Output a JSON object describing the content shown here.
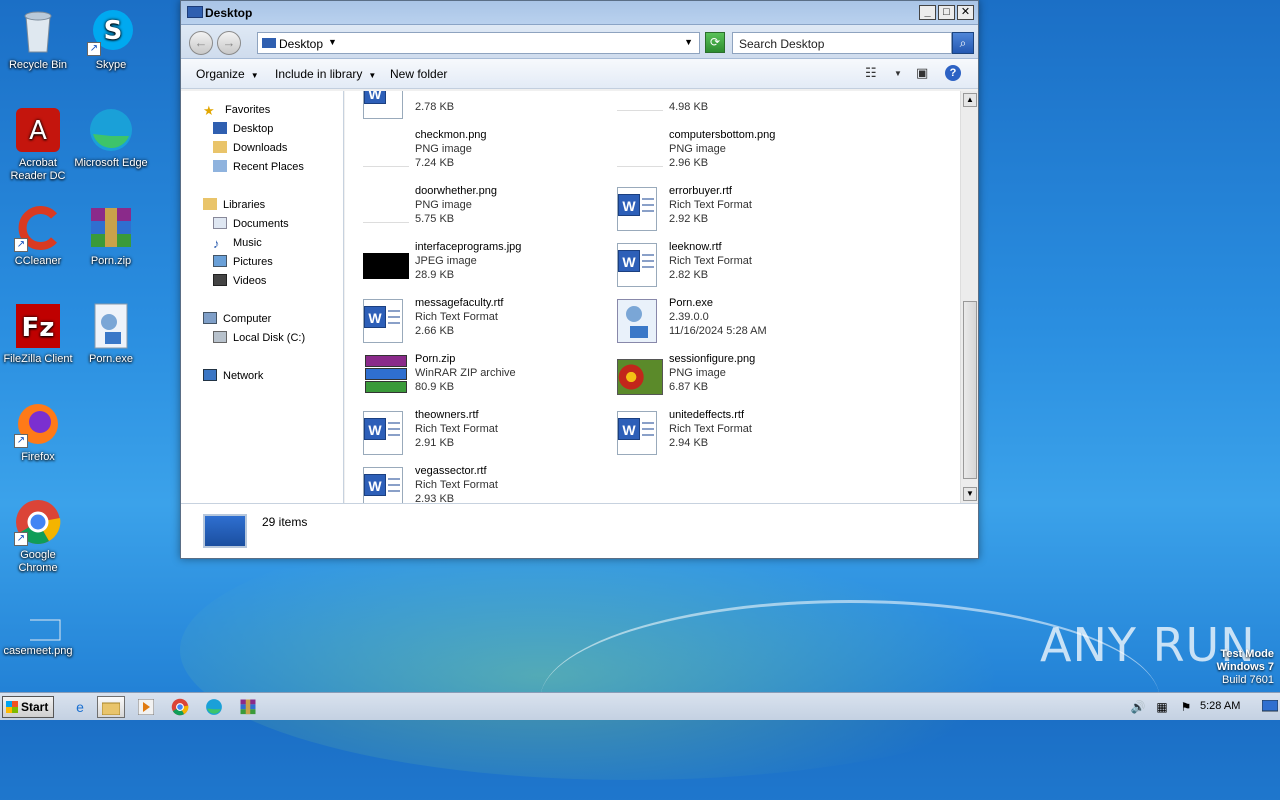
{
  "desktop": {
    "icons": [
      {
        "label": "Recycle Bin"
      },
      {
        "label": "Skype"
      },
      {
        "label": "Acrobat Reader DC"
      },
      {
        "label": "Microsoft Edge"
      },
      {
        "label": "CCleaner"
      },
      {
        "label": "Porn.zip"
      },
      {
        "label": "FileZilla Client"
      },
      {
        "label": "Porn.exe"
      },
      {
        "label": "Firefox"
      },
      {
        "label": "Google Chrome"
      },
      {
        "label": "casemeet.png"
      }
    ]
  },
  "window": {
    "title": "Desktop",
    "address": "Desktop",
    "search_placeholder": "Search Desktop",
    "toolbar": {
      "organize": "Organize",
      "include_in_library": "Include in library",
      "new_folder": "New folder"
    },
    "nav": {
      "favorites": "Favorites",
      "desktop": "Desktop",
      "downloads": "Downloads",
      "recent_places": "Recent Places",
      "libraries": "Libraries",
      "documents": "Documents",
      "music": "Music",
      "pictures": "Pictures",
      "videos": "Videos",
      "computer": "Computer",
      "local_disk": "Local Disk (C:)",
      "network": "Network"
    },
    "files": [
      {
        "name": "",
        "type": "",
        "size": "2.78 KB",
        "icon": "rtf"
      },
      {
        "name": "",
        "type": "",
        "size": "4.98 KB",
        "icon": "png-blank"
      },
      {
        "name": "checkmon.png",
        "type": "PNG image",
        "size": "7.24 KB",
        "icon": "png-blank"
      },
      {
        "name": "computersbottom.png",
        "type": "PNG image",
        "size": "2.96 KB",
        "icon": "png-blank"
      },
      {
        "name": "doorwhether.png",
        "type": "PNG image",
        "size": "5.75 KB",
        "icon": "png-blank"
      },
      {
        "name": "errorbuyer.rtf",
        "type": "Rich Text Format",
        "size": "2.92 KB",
        "icon": "rtf"
      },
      {
        "name": "interfaceprograms.jpg",
        "type": "JPEG image",
        "size": "28.9 KB",
        "icon": "jpg-black"
      },
      {
        "name": "leeknow.rtf",
        "type": "Rich Text Format",
        "size": "2.82 KB",
        "icon": "rtf"
      },
      {
        "name": "messagefaculty.rtf",
        "type": "Rich Text Format",
        "size": "2.66 KB",
        "icon": "rtf"
      },
      {
        "name": "Porn.exe",
        "type": "2.39.0.0",
        "size": "11/16/2024 5:28 AM",
        "icon": "exe"
      },
      {
        "name": "Porn.zip",
        "type": "WinRAR ZIP archive",
        "size": "80.9 KB",
        "icon": "zip"
      },
      {
        "name": "sessionfigure.png",
        "type": "PNG image",
        "size": "6.87 KB",
        "icon": "flower"
      },
      {
        "name": "theowners.rtf",
        "type": "Rich Text Format",
        "size": "2.91 KB",
        "icon": "rtf"
      },
      {
        "name": "unitedeffects.rtf",
        "type": "Rich Text Format",
        "size": "2.94 KB",
        "icon": "rtf"
      },
      {
        "name": "vegassector.rtf",
        "type": "Rich Text Format",
        "size": "2.93 KB",
        "icon": "rtf"
      }
    ],
    "details": {
      "count": "29 items"
    }
  },
  "taskbar": {
    "start": "Start",
    "clock": "5:28 AM"
  },
  "watermark": "ANY RUN",
  "testmode": {
    "line1": "Test Mode",
    "line2": "Windows 7",
    "line3": "Build 7601"
  }
}
